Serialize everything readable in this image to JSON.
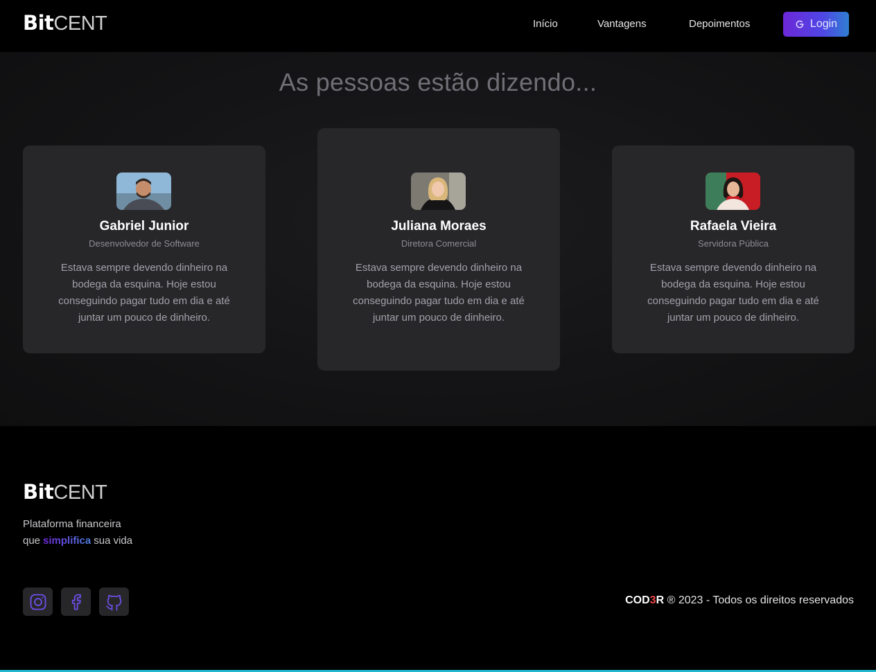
{
  "brand": {
    "bold": "Bit",
    "light": "CENT"
  },
  "nav": {
    "items": [
      "Início",
      "Vantagens",
      "Depoimentos"
    ],
    "login_label": "Login"
  },
  "testimonials": {
    "title": "As pessoas estão dizendo...",
    "cards": [
      {
        "name": "Gabriel Junior",
        "role": "Desenvolvedor de Software",
        "text": "Estava sempre devendo dinheiro na bodega da esquina. Hoje estou conseguindo pagar tudo em dia e até juntar um pouco de dinheiro."
      },
      {
        "name": "Juliana Moraes",
        "role": "Diretora Comercial",
        "text": "Estava sempre devendo dinheiro na bodega da esquina. Hoje estou conseguindo pagar tudo em dia e até juntar um pouco de dinheiro."
      },
      {
        "name": "Rafaela Vieira",
        "role": "Servidora Pública",
        "text": "Estava sempre devendo dinheiro na bodega da esquina. Hoje estou conseguindo pagar tudo em dia e até juntar um pouco de dinheiro."
      }
    ]
  },
  "footer": {
    "tagline_line1": "Plataforma financeira",
    "tagline_pre": "que",
    "tagline_highlight": "simplifica",
    "tagline_post": "sua vida",
    "social": [
      "instagram-icon",
      "facebook-icon",
      "github-icon"
    ],
    "copyright_brand_a": "COD",
    "copyright_brand_b": "3",
    "copyright_brand_c": "R",
    "copyright_text": " ® 2023 - Todos os direitos reservados"
  },
  "colors": {
    "accent": "#6d28d9",
    "accent2": "#4f46e5",
    "card": "#27272a",
    "bottom_bar": "#22b8cf"
  }
}
